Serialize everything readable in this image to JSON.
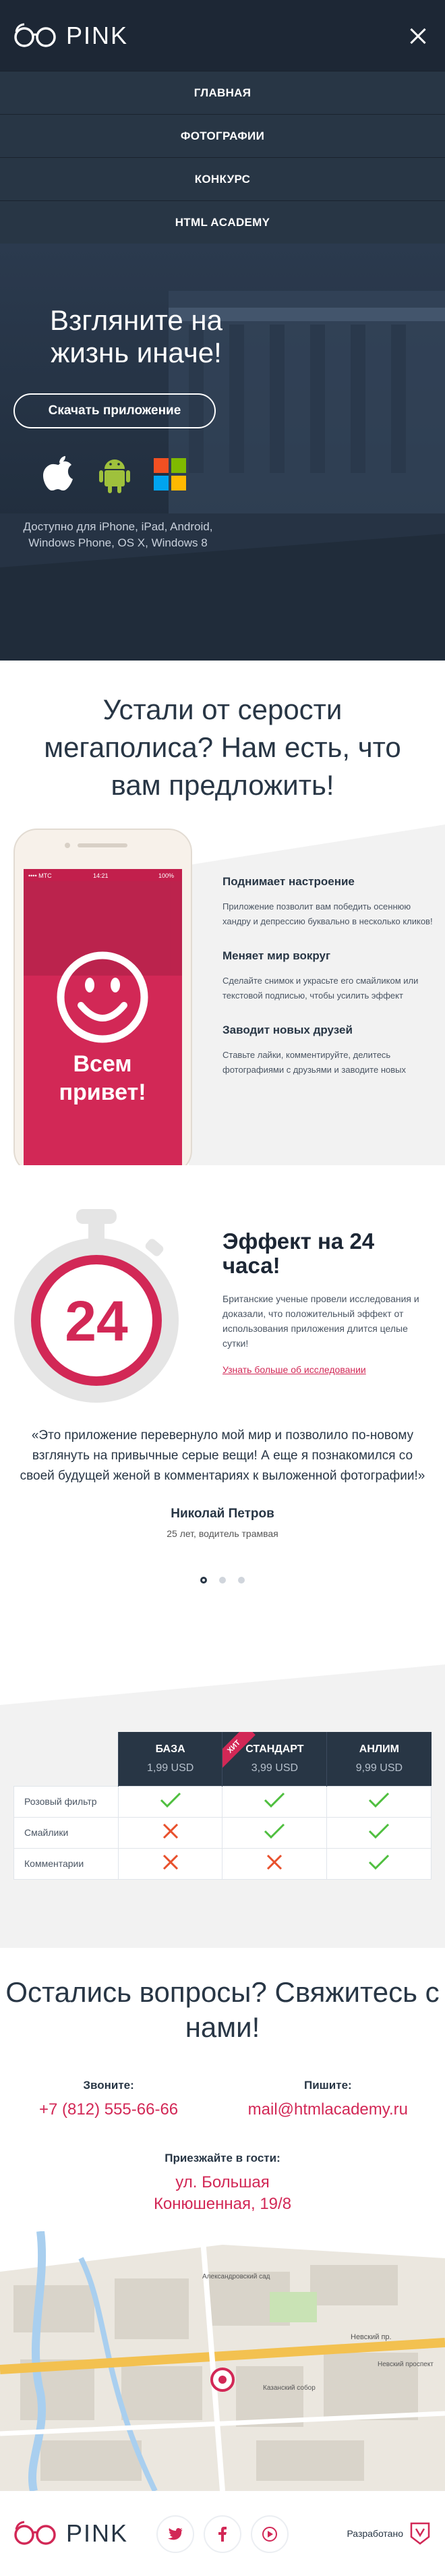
{
  "header": {
    "logo_text": "PINK",
    "nav": [
      "ГЛАВНАЯ",
      "ФОТОГРАФИИ",
      "КОНКУРС",
      "HTML ACADEMY"
    ]
  },
  "hero": {
    "title": "Взгляните на жизнь иначе!",
    "button": "Скачать приложение",
    "platforms": [
      "apple-icon",
      "android-icon",
      "windows-icon"
    ],
    "note": "Доступно для iPhone, iPad, Android, Windows Phone, OS X, Windows 8"
  },
  "promo": {
    "title": "Устали от серости мегаполиса? Нам есть, что вам предложить!",
    "phone_status": "•••• MTC",
    "phone_time": "14:21",
    "phone_battery": "100%",
    "phone_caption": "Всем привет!",
    "features": [
      {
        "title": "Поднимает настроение",
        "text": "Приложение позволит вам победить осеннюю хандру и депрессию буквально в несколько кликов!"
      },
      {
        "title": "Меняет мир вокруг",
        "text": "Сделайте снимок и украсьте его смайликом или текстовой подписью, чтобы усилить эффект"
      },
      {
        "title": "Заводит новых друзей",
        "text": "Ставьте лайки, комментируйте, делитесь фотографиями с друзьями и заводите новых"
      }
    ]
  },
  "effect": {
    "timer_value": "24",
    "title": "Эффект на 24 часа!",
    "text": "Британские ученые провели исследования и доказали, что положительный эффект от использования приложения длится целые сутки!",
    "link": "Узнать больше об исследовании"
  },
  "review": {
    "text": "«Это приложение перевернуло мой мир и позволило по-новому взглянуть на привычные серые вещи! А еще я познакомился со своей будущей женой в комментариях к выложенной фотографии!»",
    "author": "Николай Петров",
    "role": "25 лет, водитель трамвая",
    "slides": 3,
    "active_slide": 1
  },
  "prices": {
    "plans": [
      {
        "name": "БАЗА",
        "price": "1,99 USD"
      },
      {
        "name": "СТАНДАРТ",
        "price": "3,99 USD",
        "badge": "ХИТ"
      },
      {
        "name": "АНЛИМ",
        "price": "9,99 USD"
      }
    ],
    "rows": [
      {
        "feature": "Розовый фильтр",
        "values": [
          true,
          true,
          true
        ]
      },
      {
        "feature": "Смайлики",
        "values": [
          false,
          true,
          true
        ]
      },
      {
        "feature": "Комментарии",
        "values": [
          false,
          false,
          true
        ]
      }
    ]
  },
  "contacts": {
    "title": "Остались вопросы? Свяжитесь с нами!",
    "phone_label": "Звоните:",
    "phone": "+7 (812) 555-66-66",
    "email_label": "Пишите:",
    "email": "mail@htmlacademy.ru",
    "address_label": "Приезжайте в гости:",
    "address": "ул. Большая Конюшенная, 19/8"
  },
  "map": {
    "labels": [
      "Невский пр.",
      "Невский проспект",
      "Казанский собор",
      "Александровский сад"
    ]
  },
  "footer": {
    "logo_text": "PINK",
    "socials": [
      "twitter-icon",
      "facebook-icon",
      "youtube-icon"
    ],
    "made_by": "Разработано"
  },
  "colors": {
    "accent": "#d22856",
    "dark": "#283645",
    "navy": "#1d2735",
    "check": "#4fbf3f"
  }
}
